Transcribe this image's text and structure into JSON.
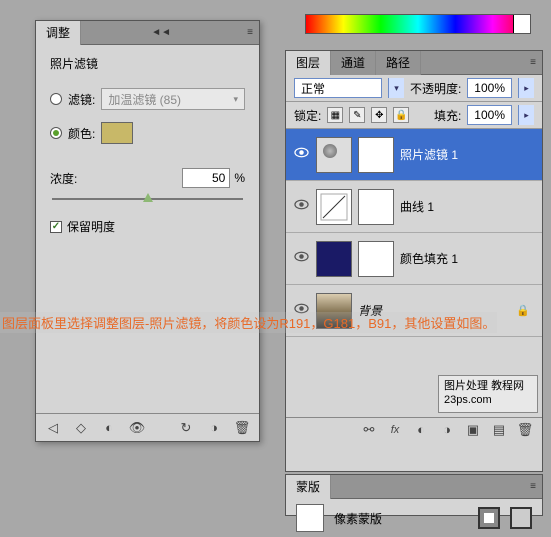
{
  "adjustments": {
    "tab": "调整",
    "title": "照片滤镜",
    "filter_label": "滤镜:",
    "filter_value": "加温滤镜 (85)",
    "color_label": "颜色:",
    "color_hex": "#c8b868",
    "density_label": "浓度:",
    "density_value": "50",
    "density_unit": "%",
    "preserve_label": "保留明度"
  },
  "layers": {
    "tabs": [
      "图层",
      "通道",
      "路径"
    ],
    "blend_mode": "正常",
    "opacity_label": "不透明度:",
    "opacity_value": "100%",
    "lock_label": "锁定:",
    "fill_label": "填充:",
    "fill_value": "100%",
    "items": [
      {
        "name": "照片滤镜 1",
        "type": "photofilter",
        "visible": true,
        "selected": true,
        "mask": true
      },
      {
        "name": "曲线 1",
        "type": "curves",
        "visible": true,
        "selected": false,
        "mask": true
      },
      {
        "name": "颜色填充 1",
        "type": "solidfill",
        "visible": true,
        "selected": false,
        "mask": true
      },
      {
        "name": "背景",
        "type": "background",
        "visible": true,
        "selected": false,
        "mask": false,
        "locked": true
      }
    ]
  },
  "masks": {
    "tab": "蒙版",
    "label": "像素蒙版"
  },
  "watermark": {
    "line1": "图片处理",
    "line2": "23ps.com",
    "line3": "教程网"
  },
  "overlay": "图层面板里选择调整图层-照片滤镜，将颜色设为R191，G181，B91，其他设置如图。",
  "icons": {
    "menu": "≡",
    "collapse": "◄◄"
  }
}
